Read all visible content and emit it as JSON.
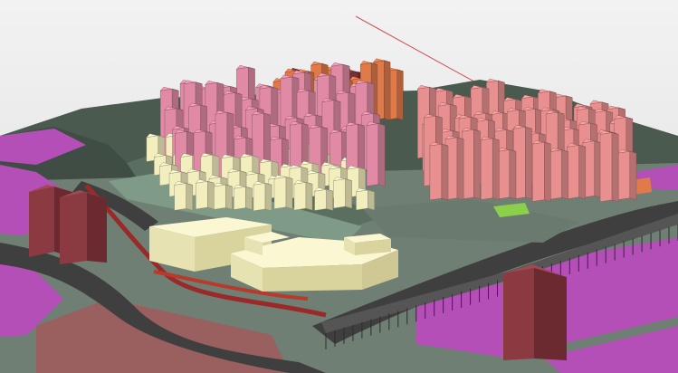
{
  "scene": {
    "kind": "3d-urban-massing-model",
    "colors": {
      "sky": "#e6e6e6",
      "ground": "#6f7f73",
      "hill": "#4a5a4f",
      "road": "#3f3f3f",
      "red_path": "#9a2a2a",
      "magenta_plot": "#b44fb8",
      "brown_plot": "#9a5f5f",
      "cream_building": "#f2eebe",
      "pink_tower": "#e08aa5",
      "orange_tower": "#e07a4a",
      "maroon_tower": "#7a2f35",
      "salmon_tower": "#e89090",
      "lime_accent": "#8ccf4a",
      "axis_line": "#d0505a"
    },
    "blocks": [
      {
        "id": "cream-cluster-west",
        "color": "cream_building"
      },
      {
        "id": "pink-cluster-center",
        "color": "pink_tower"
      },
      {
        "id": "orange-cluster-north",
        "color": "orange_tower"
      },
      {
        "id": "salmon-cluster-east",
        "color": "salmon_tower"
      },
      {
        "id": "maroon-towers-sw",
        "color": "maroon_tower"
      },
      {
        "id": "maroon-tower-se",
        "color": "maroon_tower"
      },
      {
        "id": "podium-complex",
        "color": "cream_building"
      }
    ]
  }
}
